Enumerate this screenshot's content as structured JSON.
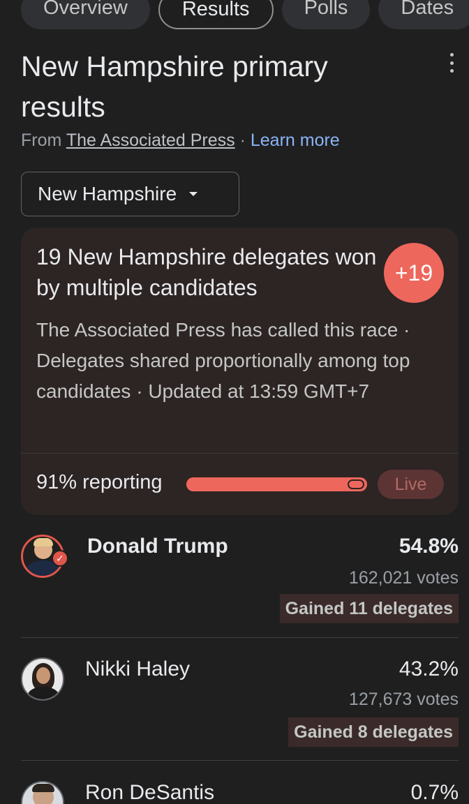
{
  "tabs": [
    {
      "label": "Overview",
      "active": false
    },
    {
      "label": "Results",
      "active": true
    },
    {
      "label": "Polls",
      "active": false
    },
    {
      "label": "Dates",
      "active": false
    }
  ],
  "header": {
    "title": "New Hampshire primary results",
    "source_prefix": "From",
    "source_name": "The Associated Press",
    "separator": "·",
    "learn_more": "Learn more",
    "menu_icon": "more-vert-icon"
  },
  "region_select": {
    "value": "New Hampshire",
    "icon": "caret-down-icon"
  },
  "summary": {
    "headline": "19 New Hampshire delegates won by multiple candidates",
    "badge": "+19",
    "description": "The Associated Press has called this race · Delegates shared proportionally among top candidates · Updated at 13:59 GMT+7",
    "reporting_label": "91% reporting",
    "reporting_fraction": 0.91,
    "live_label": "Live",
    "accent_color": "#ee675c"
  },
  "candidates": [
    {
      "name": "Donald Trump",
      "percent": "54.8%",
      "votes": "162,021 votes",
      "delegates": "Gained 11 delegates",
      "winner": true
    },
    {
      "name": "Nikki Haley",
      "percent": "43.2%",
      "votes": "127,673 votes",
      "delegates": "Gained 8 delegates",
      "winner": false
    },
    {
      "name": "Ron DeSantis",
      "percent": "0.7%",
      "winner": false
    }
  ]
}
